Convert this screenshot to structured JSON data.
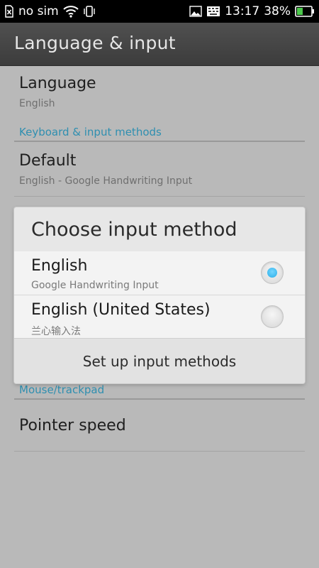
{
  "statusbar": {
    "carrier": "no sim",
    "time": "13:17",
    "battery": "38%",
    "icons": [
      "no-sim-icon",
      "wifi-icon",
      "vibrate-icon",
      "image-icon",
      "keyboard-icon",
      "battery-icon"
    ]
  },
  "actionbar": {
    "title": "Language & input"
  },
  "settings": {
    "language": {
      "title": "Language",
      "summary": "English"
    },
    "category_keyboard": "Keyboard & input methods",
    "default": {
      "title": "Default",
      "summary": "English - Google Handwriting Input"
    },
    "category_mouse": "Mouse/trackpad",
    "pointer_speed": {
      "title": "Pointer speed"
    }
  },
  "dialog": {
    "title": "Choose input method",
    "options": [
      {
        "label": "English",
        "summary": "Google Handwriting Input",
        "selected": true
      },
      {
        "label": "English (United States)",
        "summary": "兰心输入法",
        "selected": false
      }
    ],
    "setup_label": "Set up input methods"
  },
  "colors": {
    "accent": "#2f8fb0",
    "radio_selected": "#2aaee8",
    "actionbar": "#464646"
  }
}
